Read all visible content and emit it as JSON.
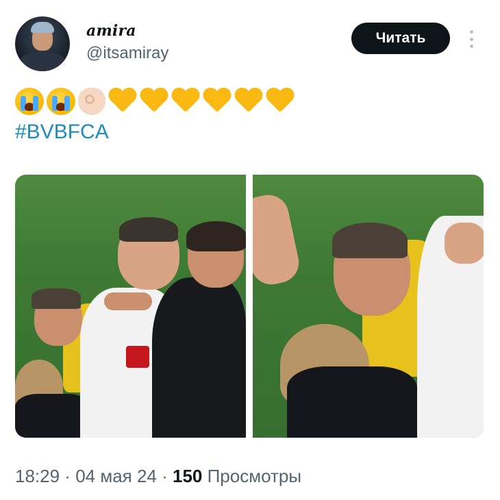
{
  "user": {
    "display_name": "amira",
    "handle": "@itsamiray"
  },
  "actions": {
    "follow_label": "Читать",
    "more_icon": "more-vertical-icon"
  },
  "tweet": {
    "emojis": [
      "loudly-crying-face",
      "loudly-crying-face",
      "ok-hand",
      "yellow-heart",
      "yellow-heart",
      "yellow-heart",
      "yellow-heart",
      "yellow-heart",
      "yellow-heart"
    ],
    "hashtag": "#BVBFCA"
  },
  "media": {
    "count": 2
  },
  "meta": {
    "time": "18:29",
    "separator1": " · ",
    "date": "04 мая 24",
    "separator2": " · ",
    "views_count": "150",
    "views_label": " Просмотры"
  },
  "colors": {
    "text": "#0f1419",
    "secondary": "#536471",
    "hashtag": "#1d8bbf",
    "follow_bg": "#0f1419",
    "heart": "#f9b912"
  }
}
